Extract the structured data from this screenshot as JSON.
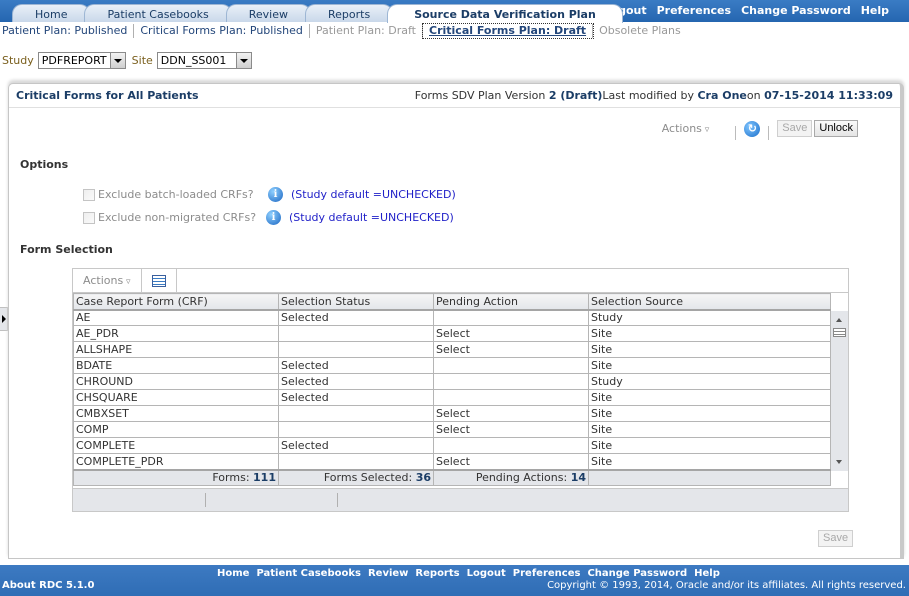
{
  "tabs": [
    {
      "label": "Home",
      "active": false
    },
    {
      "label": "Patient Casebooks",
      "active": false
    },
    {
      "label": "Review",
      "active": false
    },
    {
      "label": "Reports",
      "active": false
    },
    {
      "label": "Source Data Verification Plan",
      "active": true
    }
  ],
  "global_links": [
    "Logout",
    "Preferences",
    "Change Password",
    "Help"
  ],
  "subnav": [
    {
      "label": "Patient Plan: Published",
      "state": "normal"
    },
    {
      "label": "Critical Forms Plan: Published",
      "state": "normal"
    },
    {
      "label": "Patient Plan: Draft",
      "state": "disabled"
    },
    {
      "label": "Critical Forms Plan: Draft",
      "state": "current"
    },
    {
      "label": "Obsolete Plans",
      "state": "disabled"
    }
  ],
  "context": {
    "study_label": "Study",
    "study_value": "PDFREPORT",
    "site_label": "Site",
    "site_value": "DDN_SS001"
  },
  "panel": {
    "title": "Critical Forms for All Patients",
    "version_prefix": "Forms SDV Plan Version",
    "version": "2 (Draft)",
    "modified_prefix": "Last modified by",
    "modified_by": "Cra One",
    "on_label": "on",
    "modified_at": "07-15-2014 11:33:09"
  },
  "toolbar": {
    "actions_label": "Actions",
    "save_label": "Save",
    "unlock_label": "Unlock"
  },
  "options": {
    "title": "Options",
    "items": [
      {
        "label": "Exclude batch-loaded CRFs?",
        "checked": false,
        "default_text": "(Study default =UNCHECKED)"
      },
      {
        "label": "Exclude non-migrated CRFs?",
        "checked": false,
        "default_text": "(Study default =UNCHECKED)"
      }
    ]
  },
  "form_selection": {
    "title": "Form Selection",
    "actions_label": "Actions",
    "columns": [
      "Case Report Form (CRF)",
      "Selection Status",
      "Pending Action",
      "Selection Source"
    ],
    "rows": [
      [
        "AE",
        "Selected",
        "",
        "Study"
      ],
      [
        "AE_PDR",
        "",
        "Select",
        "Site"
      ],
      [
        "ALLSHAPE",
        "",
        "Select",
        "Site"
      ],
      [
        "BDATE",
        "Selected",
        "",
        "Site"
      ],
      [
        "CHROUND",
        "Selected",
        "",
        "Study"
      ],
      [
        "CHSQUARE",
        "Selected",
        "",
        "Site"
      ],
      [
        "CMBXSET",
        "",
        "Select",
        "Site"
      ],
      [
        "COMP",
        "",
        "Select",
        "Site"
      ],
      [
        "COMPLETE",
        "Selected",
        "",
        "Site"
      ],
      [
        "COMPLETE_PDR",
        "",
        "Select",
        "Site"
      ]
    ],
    "totals": {
      "forms_label": "Forms:",
      "forms": "111",
      "selected_label": "Forms Selected:",
      "selected": "36",
      "pending_label": "Pending Actions:",
      "pending": "14"
    }
  },
  "bottom_save_label": "Save",
  "footer": {
    "links": [
      "Home",
      "Patient Casebooks",
      "Review",
      "Reports",
      "Logout",
      "Preferences",
      "Change Password",
      "Help"
    ],
    "about": "About RDC 5.1.0",
    "copyright": "Copyright © 1993, 2014, Oracle and/or its affiliates. All rights reserved."
  }
}
